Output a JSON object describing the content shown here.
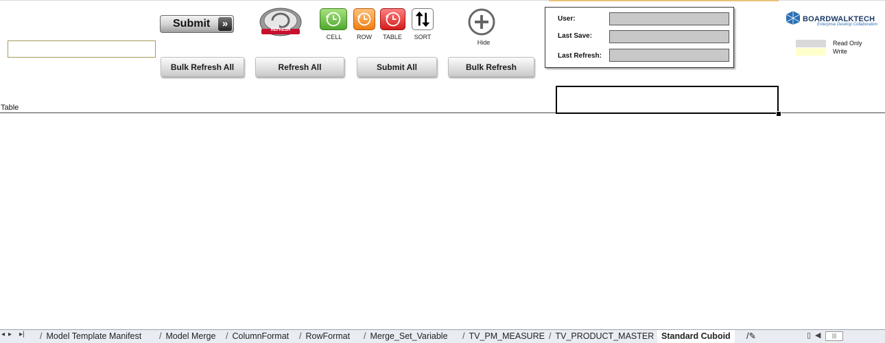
{
  "toolbar": {
    "submit_label": "Submit",
    "refresh_label": "REFRESH",
    "cell_label": "CELL",
    "row_label": "ROW",
    "table_label": "TABLE",
    "sort_label": "SORT",
    "hide_label": "Hide",
    "buttons": [
      "Bulk Refresh All",
      "Refresh All",
      "Submit All",
      "Bulk Refresh"
    ]
  },
  "info": {
    "user_label": "User:",
    "user_value": "",
    "last_save_label": "Last Save:",
    "last_save_value": "",
    "last_refresh_label": "Last Refresh:",
    "last_refresh_value": ""
  },
  "brand": {
    "name": "BOARDWALKTECH",
    "tagline": "Enterprise Desktop Collaboration"
  },
  "legend": {
    "read_only_label": "Read Only",
    "read_only_color": "#d9d9d9",
    "write_label": "Write",
    "write_color": "#ffffcc"
  },
  "sheet": {
    "table_label": "Table"
  },
  "tabs": {
    "items": [
      "Model Template Manifest",
      "Model Merge",
      "ColumnFormat",
      "RowFormat",
      "Merge_Set_Variable",
      "TV_PM_MEASURE",
      "TV_PRODUCT_MASTER",
      "Standard Cuboid"
    ],
    "active": "Standard Cuboid"
  },
  "colors": {
    "cell_green": "#4fa82e",
    "row_orange": "#f07d12",
    "table_red": "#d41b1b",
    "brand_blue": "#2a6fb5"
  }
}
